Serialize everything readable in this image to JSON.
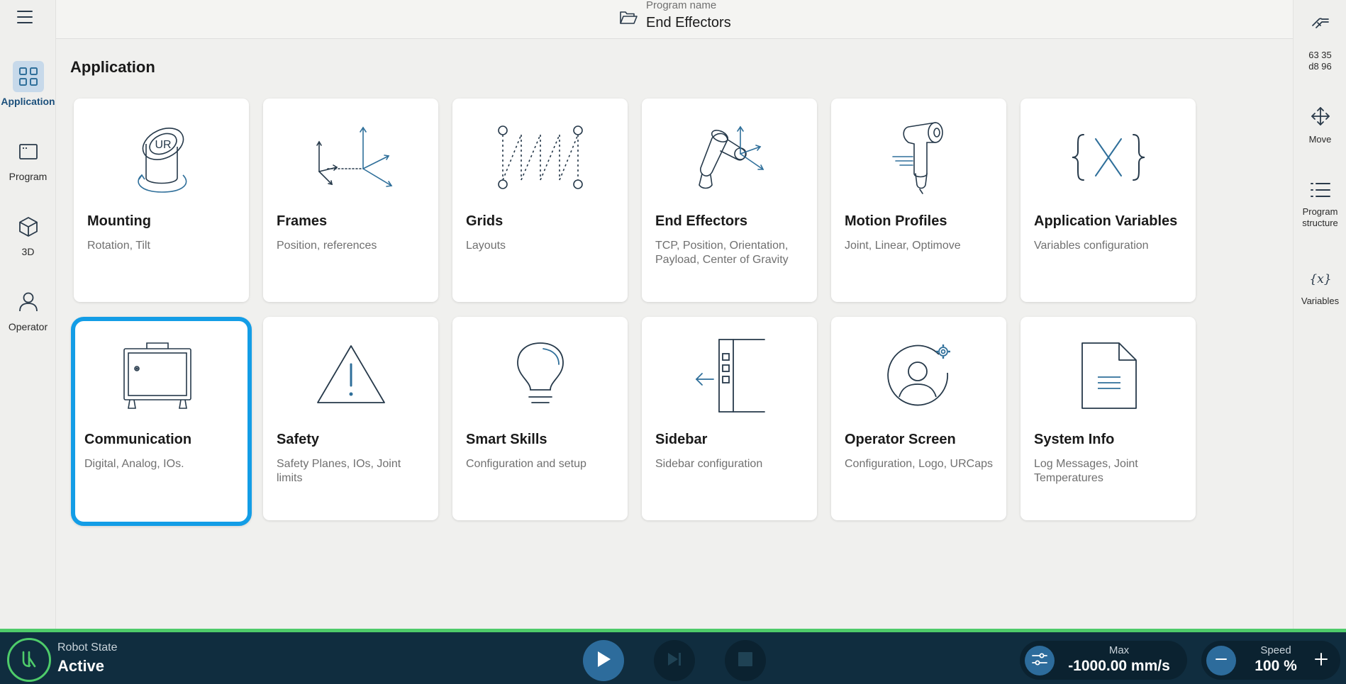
{
  "topbar": {
    "program_label": "Program name",
    "program_name": "End Effectors"
  },
  "leftnav": {
    "items": [
      {
        "label": "Application",
        "icon": "grid-icon"
      },
      {
        "label": "Program",
        "icon": "program-icon"
      },
      {
        "label": "3D",
        "icon": "cube-icon"
      },
      {
        "label": "Operator",
        "icon": "person-icon"
      }
    ]
  },
  "rightbar": {
    "ip_line1": "63 35",
    "ip_line2": "d8 96",
    "move": "Move",
    "program_structure": "Program structure",
    "variables": "Variables"
  },
  "main": {
    "title": "Application",
    "cards": [
      {
        "title": "Mounting",
        "desc": "Rotation, Tilt"
      },
      {
        "title": "Frames",
        "desc": "Position, references"
      },
      {
        "title": "Grids",
        "desc": "Layouts"
      },
      {
        "title": "End Effectors",
        "desc": "TCP, Position, Orientation, Payload, Center of Gravity"
      },
      {
        "title": "Motion Profiles",
        "desc": "Joint, Linear, Optimove"
      },
      {
        "title": "Application Variables",
        "desc": "Variables configuration"
      },
      {
        "title": "Communication",
        "desc": "Digital, Analog, IOs."
      },
      {
        "title": "Safety",
        "desc": "Safety Planes, IOs, Joint limits"
      },
      {
        "title": "Smart Skills",
        "desc": "Configuration and setup"
      },
      {
        "title": "Sidebar",
        "desc": "Sidebar configuration"
      },
      {
        "title": "Operator Screen",
        "desc": "Configuration, Logo, URCaps"
      },
      {
        "title": "System Info",
        "desc": "Log Messages, Joint Temperatures"
      }
    ],
    "selected_card": "Communication"
  },
  "bottombar": {
    "robot_state_label": "Robot State",
    "robot_state_value": "Active",
    "max_label": "Max",
    "max_value": "-1000.00 mm/s",
    "speed_label": "Speed",
    "speed_value": "100 %"
  },
  "colors": {
    "accent_blue": "#139de6",
    "icon_blue": "#2f6f9a",
    "green": "#4ecb6a",
    "bottombar": "#102d3f"
  }
}
